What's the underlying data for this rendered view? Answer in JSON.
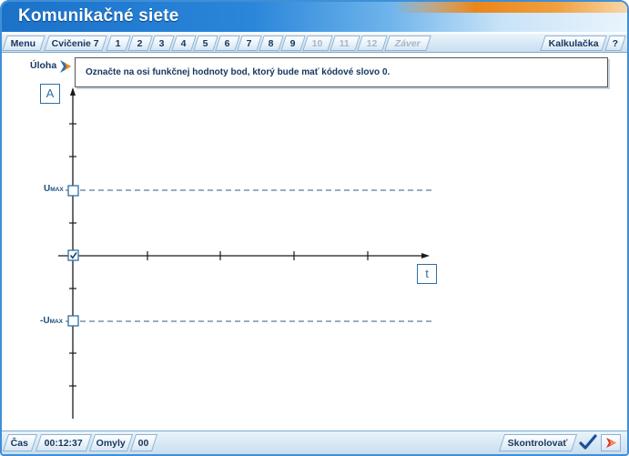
{
  "app": {
    "title": "Komunikačné siete"
  },
  "tabs": [
    {
      "label": "Menu",
      "disabled": false
    },
    {
      "label": "Cvičenie 7",
      "disabled": false
    },
    {
      "label": "1",
      "disabled": false
    },
    {
      "label": "2",
      "disabled": false
    },
    {
      "label": "3",
      "disabled": false
    },
    {
      "label": "4",
      "disabled": false
    },
    {
      "label": "5",
      "disabled": false
    },
    {
      "label": "6",
      "disabled": false
    },
    {
      "label": "7",
      "disabled": false
    },
    {
      "label": "8",
      "disabled": false
    },
    {
      "label": "9",
      "disabled": false
    },
    {
      "label": "10",
      "disabled": true
    },
    {
      "label": "11",
      "disabled": true
    },
    {
      "label": "12",
      "disabled": true
    },
    {
      "label": "Záver",
      "disabled": true
    }
  ],
  "right_tabs": {
    "calculator": "Kalkulačka",
    "help": "?"
  },
  "task": {
    "label": "Úloha",
    "text": "Označte na osi funkčnej hodnoty bod, ktorý bude mať kódové slovo 0."
  },
  "graph": {
    "y_axis_label": "A",
    "x_axis_label": "t",
    "umax_label": "U",
    "umax_sub": "MAX",
    "neg_umax_label": "-U",
    "neg_umax_sub": "MAX",
    "points": [
      {
        "name": "umax",
        "checked": false
      },
      {
        "name": "zero",
        "checked": true
      },
      {
        "name": "neg-umax",
        "checked": false
      }
    ]
  },
  "status": {
    "time_label": "Čas",
    "time_value": "00:12:37",
    "errors_label": "Omyly",
    "errors_value": "00",
    "check_label": "Skontrolovať"
  },
  "colors": {
    "accent": "#1b72c9",
    "orange": "#e9861b",
    "text_dark": "#15365f",
    "axis": "#1a1a1a",
    "box": "#2f6fa5"
  }
}
